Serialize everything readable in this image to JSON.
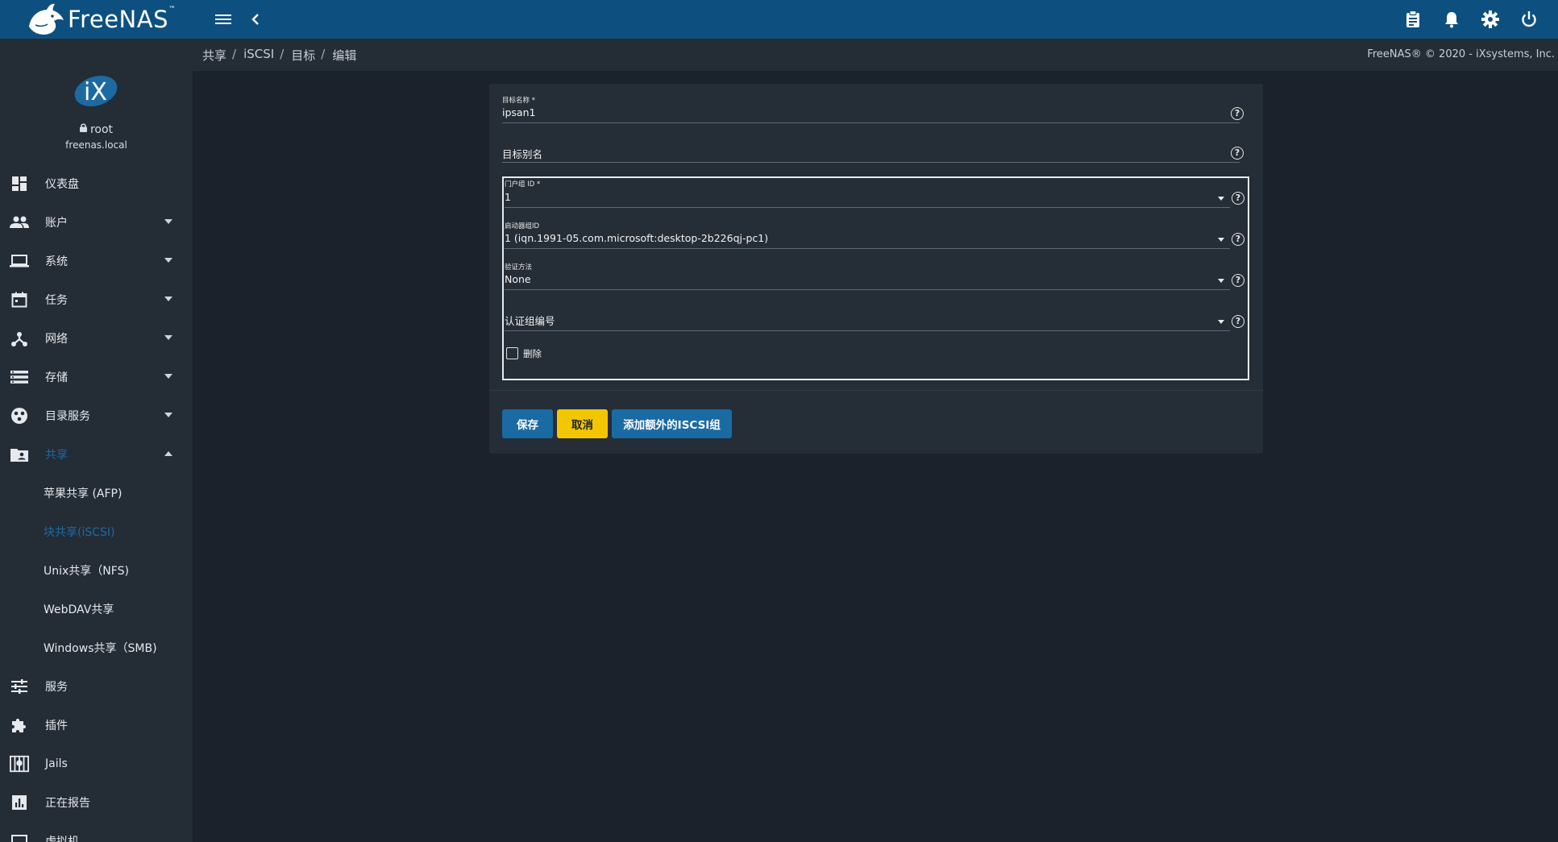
{
  "app": {
    "logo_text": "FreeNAS",
    "logo_mark": "™"
  },
  "topbar": {
    "icons": [
      "menu-icon",
      "back-chevron-icon",
      "clipboard-icon",
      "bell-icon",
      "gear-icon",
      "power-icon"
    ]
  },
  "breadcrumb": [
    "共享",
    "iSCSI",
    "目标",
    "编辑"
  ],
  "copyright": "FreeNAS® © 2020 - iXsystems, Inc.",
  "user": {
    "avatar_text": "iX",
    "name": "root",
    "host": "freenas.local"
  },
  "sidebar": {
    "items": [
      {
        "label": "仪表盘",
        "icon": "dashboard-icon"
      },
      {
        "label": "账户",
        "icon": "people-icon"
      },
      {
        "label": "系统",
        "icon": "laptop-icon"
      },
      {
        "label": "任务",
        "icon": "calendar-icon"
      },
      {
        "label": "网络",
        "icon": "network-icon"
      },
      {
        "label": "存储",
        "icon": "storage-icon"
      },
      {
        "label": "目录服务",
        "icon": "directory-icon"
      },
      {
        "label": "共享",
        "icon": "folder-shared-icon"
      },
      {
        "label": "服务",
        "icon": "tune-icon"
      },
      {
        "label": "插件",
        "icon": "puzzle-icon"
      },
      {
        "label": "Jails",
        "icon": "jail-icon"
      },
      {
        "label": "正在报告",
        "icon": "chart-icon"
      },
      {
        "label": "虚拟机",
        "icon": "vm-icon"
      }
    ],
    "sub_items": [
      {
        "label": "苹果共享 (AFP)"
      },
      {
        "label": "块共享(iSCSI)"
      },
      {
        "label": "Unix共享（NFS)"
      },
      {
        "label": "WebDAV共享"
      },
      {
        "label": "Windows共享（SMB)"
      }
    ]
  },
  "form": {
    "target_name": {
      "label": "目标名称 *",
      "value": "ipsan1"
    },
    "target_alias": {
      "label": "目标别名",
      "value": ""
    },
    "portal_group": {
      "label": "门户组 ID *",
      "value": "1"
    },
    "initiator_group": {
      "label": "启动器组ID",
      "value": "1 (iqn.1991-05.com.microsoft:desktop-2b226qj-pc1)"
    },
    "auth_method": {
      "label": "验证方法",
      "value": "None"
    },
    "auth_group": {
      "label": "认证组编号",
      "value": ""
    },
    "delete": {
      "label": "删除",
      "checked": false
    },
    "help_glyph": "?"
  },
  "buttons": {
    "save": "保存",
    "cancel": "取消",
    "add_group": "添加额外的ISCSI组"
  },
  "colors": {
    "topbar": "#0d5080",
    "sidebar": "#242c36",
    "background": "#1b222b",
    "primary": "#1a6aa4",
    "accent": "#f2c600"
  }
}
